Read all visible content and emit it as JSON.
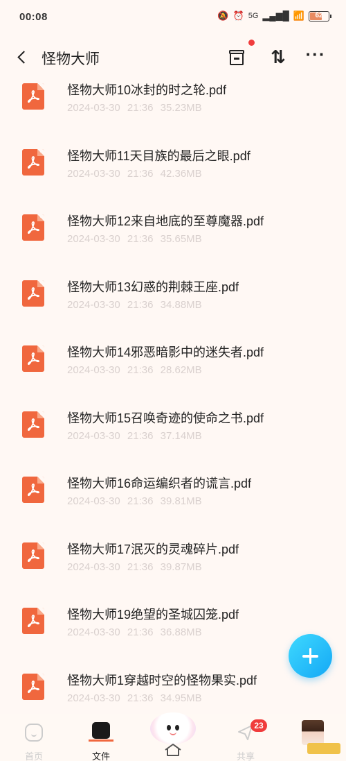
{
  "status_bar": {
    "time": "00:08",
    "network": "5G",
    "battery_level": "62"
  },
  "header": {
    "title": "怪物大师"
  },
  "files": [
    {
      "name": "怪物大师10冰封的时之轮.pdf",
      "date": "2024-03-30",
      "time": "21:36",
      "size": "35.23MB"
    },
    {
      "name": "怪物大师11天目族的最后之眼.pdf",
      "date": "2024-03-30",
      "time": "21:36",
      "size": "42.36MB"
    },
    {
      "name": "怪物大师12来自地底的至尊魔器.pdf",
      "date": "2024-03-30",
      "time": "21:36",
      "size": "35.65MB"
    },
    {
      "name": "怪物大师13幻惑的荆棘王座.pdf",
      "date": "2024-03-30",
      "time": "21:36",
      "size": "34.88MB"
    },
    {
      "name": "怪物大师14邪恶暗影中的迷失者.pdf",
      "date": "2024-03-30",
      "time": "21:36",
      "size": "28.62MB"
    },
    {
      "name": "怪物大师15召唤奇迹的使命之书.pdf",
      "date": "2024-03-30",
      "time": "21:36",
      "size": "37.14MB"
    },
    {
      "name": "怪物大师16命运编织者的谎言.pdf",
      "date": "2024-03-30",
      "time": "21:36",
      "size": "39.81MB"
    },
    {
      "name": "怪物大师17泯灭的灵魂碎片.pdf",
      "date": "2024-03-30",
      "time": "21:36",
      "size": "39.87MB"
    },
    {
      "name": "怪物大师19绝望的圣城囚笼.pdf",
      "date": "2024-03-30",
      "time": "21:36",
      "size": "36.88MB"
    },
    {
      "name": "怪物大师1穿越时空的怪物果实.pdf",
      "date": "2024-03-30",
      "time": "21:36",
      "size": "34.95MB"
    }
  ],
  "bottom_nav": {
    "home_label": "首页",
    "files_label": "文件",
    "share_label": "共享",
    "share_badge": "23"
  },
  "colors": {
    "pdf_icon": "#f0673e",
    "fab": "#14a8f5",
    "badge": "#f03c3c",
    "meta_text": "#d9d0ce"
  }
}
